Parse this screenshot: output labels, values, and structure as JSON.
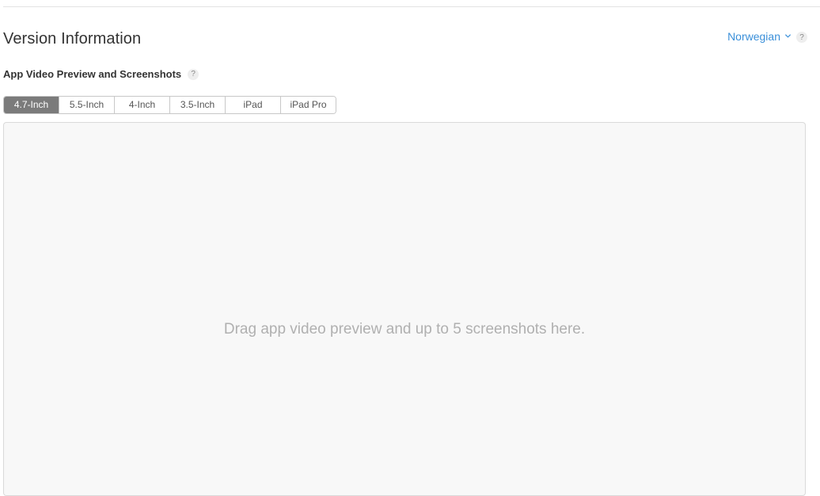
{
  "section": {
    "title": "Version Information"
  },
  "language": {
    "selected": "Norwegian",
    "help": "?"
  },
  "media": {
    "title": "App Video Preview and Screenshots",
    "help": "?",
    "tabs": [
      {
        "label": "4.7-Inch",
        "active": true
      },
      {
        "label": "5.5-Inch",
        "active": false
      },
      {
        "label": "4-Inch",
        "active": false
      },
      {
        "label": "3.5-Inch",
        "active": false
      },
      {
        "label": "iPad",
        "active": false
      },
      {
        "label": "iPad Pro",
        "active": false
      }
    ],
    "dropzone_text": "Drag app video preview and up to 5 screenshots here."
  },
  "colors": {
    "link": "#3a8fd9",
    "active_tab": "#7b7b7b",
    "dropzone_bg": "#f8f8f8"
  },
  "icons": {
    "language_chevron": "chevron-down-icon",
    "help": "question-mark-icon"
  }
}
